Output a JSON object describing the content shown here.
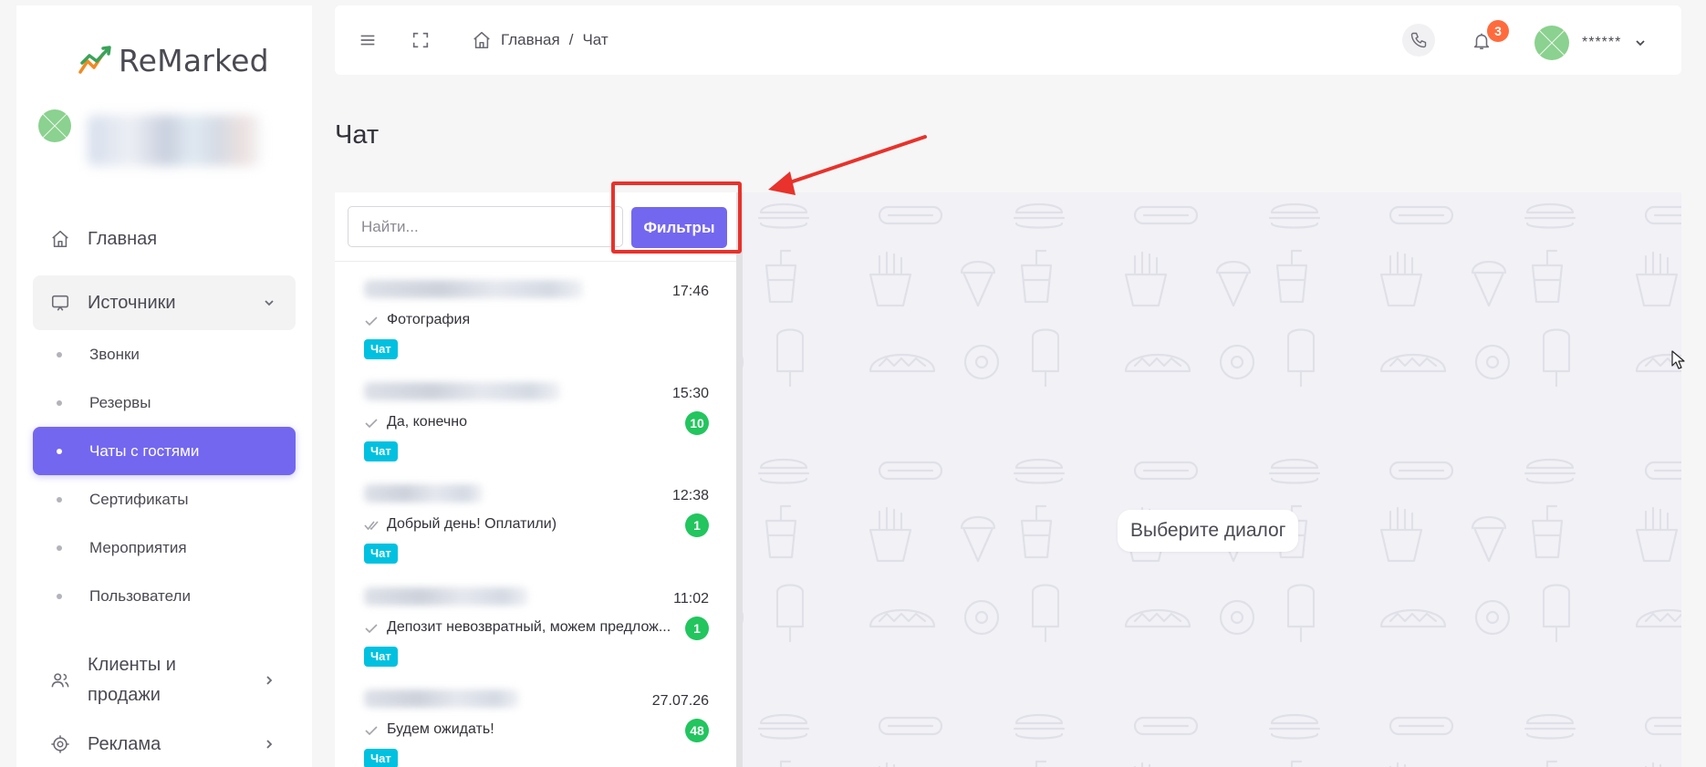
{
  "app": {
    "logo_text": "ReMarked"
  },
  "colors": {
    "accent": "#7367f0",
    "annotation": "#e8322b",
    "unread_badge": "#22c55e",
    "tag": "#00c1e0",
    "notification_badge": "#ff6b3d"
  },
  "sidebar": {
    "items": [
      {
        "label": "Главная",
        "icon": "home-icon"
      },
      {
        "label": "Источники",
        "icon": "monitor-icon",
        "expanded": true
      },
      {
        "label": "Клиенты и продажи",
        "icon": "users-icon"
      },
      {
        "label": "Реклама",
        "icon": "target-icon"
      }
    ],
    "sub_items": [
      {
        "label": "Звонки"
      },
      {
        "label": "Резервы"
      },
      {
        "label": "Чаты с гостями",
        "active": true
      },
      {
        "label": "Сертификаты"
      },
      {
        "label": "Мероприятия"
      },
      {
        "label": "Пользователи"
      }
    ]
  },
  "header": {
    "breadcrumb": [
      "Главная",
      "/",
      "Чат"
    ],
    "notification_count": "3",
    "user_name": "******"
  },
  "page": {
    "title": "Чат"
  },
  "chat_list": {
    "search_placeholder": "Найти...",
    "filter_label": "Фильтры",
    "items": [
      {
        "time": "17:46",
        "text": "Фотография",
        "unread": "",
        "tag": "Чат",
        "read_state": "single"
      },
      {
        "time": "15:30",
        "text": "Да, конечно",
        "unread": "10",
        "tag": "Чат",
        "read_state": "single"
      },
      {
        "time": "12:38",
        "text": "Добрый день! Оплатили)",
        "unread": "1",
        "tag": "Чат",
        "read_state": "double"
      },
      {
        "time": "11:02",
        "text": "Депозит невозвратный, можем предлож...",
        "unread": "1",
        "tag": "Чат",
        "read_state": "single"
      },
      {
        "time": "27.07.26",
        "text": "Будем ожидать!",
        "unread": "48",
        "tag": "Чат",
        "read_state": "single"
      }
    ]
  },
  "chat_area": {
    "placeholder": "Выберите диалог"
  }
}
